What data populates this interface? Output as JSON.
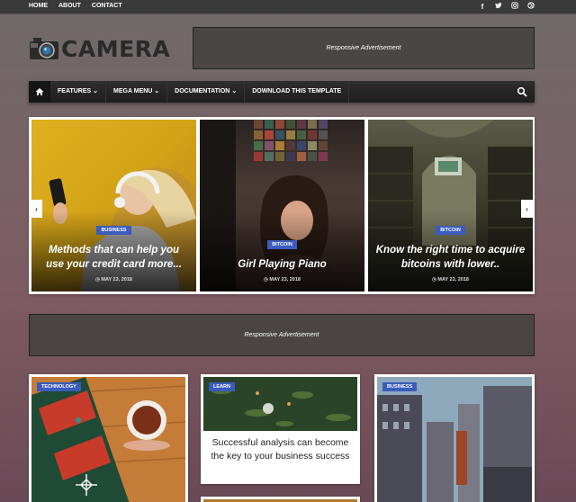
{
  "topbar": {
    "links": [
      "HOME",
      "ABOUT",
      "CONTACT"
    ],
    "social_icons": [
      "facebook-icon",
      "twitter-icon",
      "instagram-icon",
      "dribbble-icon"
    ]
  },
  "header": {
    "logo_text": "CAMERA",
    "ad_text": "Responsive Advertisement"
  },
  "nav": {
    "items": [
      "FEATURES",
      "MEGA MENU",
      "DOCUMENTATION",
      "DOWNLOAD THIS TEMPLATE"
    ]
  },
  "slider": {
    "slides": [
      {
        "category": "BUSINESS",
        "title": "Methods that can help you use your credit card more...",
        "date": "MAY 23, 2018"
      },
      {
        "category": "BITCOIN",
        "title": "Girl Playing Piano",
        "date": "MAY 23, 2018"
      },
      {
        "category": "BITCOIN",
        "title": "Know the right time to acquire bitcoins with lower..",
        "date": "MAY 23, 2018"
      }
    ]
  },
  "ad_middle": {
    "text": "Responsive Advertisement"
  },
  "posts": [
    {
      "category": "TECHNOLOGY",
      "title": ""
    },
    {
      "category": "LEARN",
      "title": "Successful analysis can become the key to your business success"
    },
    {
      "category": "BUSINESS",
      "title": ""
    }
  ],
  "colors": {
    "badge": "#3b5bbd",
    "nav_bg": "#1e1e1e",
    "topbar_bg": "#3a3a3a"
  }
}
